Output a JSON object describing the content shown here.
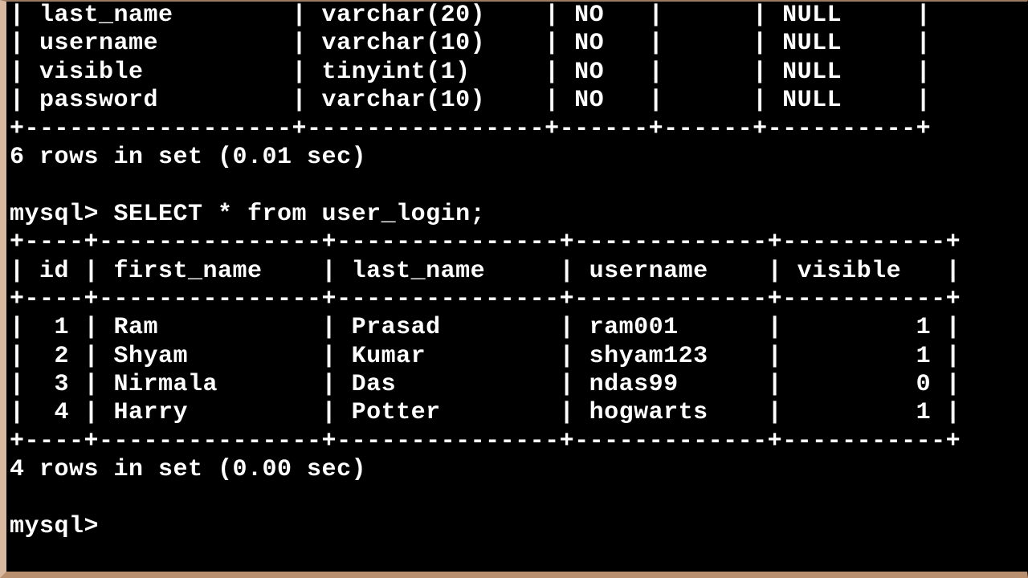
{
  "describe_table": {
    "rows": [
      {
        "field": "last_name",
        "type": "varchar(20)",
        "null": "NO",
        "key": "",
        "default": "NULL"
      },
      {
        "field": "username",
        "type": "varchar(10)",
        "null": "NO",
        "key": "",
        "default": "NULL"
      },
      {
        "field": "visible",
        "type": "tinyint(1)",
        "null": "NO",
        "key": "",
        "default": "NULL"
      },
      {
        "field": "password",
        "type": "varchar(10)",
        "null": "NO",
        "key": "",
        "default": "NULL"
      }
    ],
    "footer": "6 rows in set (0.01 sec)"
  },
  "query": {
    "prompt": "mysql>",
    "sql": "SELECT * from user_login;"
  },
  "result_table": {
    "headers": [
      "id",
      "first_name",
      "last_name",
      "username",
      "visible"
    ],
    "rows": [
      {
        "id": "1",
        "first_name": "Ram",
        "last_name": "Prasad",
        "username": "ram001",
        "visible": "1"
      },
      {
        "id": "2",
        "first_name": "Shyam",
        "last_name": "Kumar",
        "username": "shyam123",
        "visible": "1"
      },
      {
        "id": "3",
        "first_name": "Nirmala",
        "last_name": "Das",
        "username": "ndas99",
        "visible": "0"
      },
      {
        "id": "4",
        "first_name": "Harry",
        "last_name": "Potter",
        "username": "hogwarts",
        "visible": "1"
      }
    ],
    "footer": "4 rows in set (0.00 sec)"
  },
  "prompt_final": "mysql>",
  "layout": {
    "col_field": 18,
    "col_type": 16,
    "col_null": 6,
    "col_key": 6,
    "col_def": 10,
    "c_id": 4,
    "c_fn": 15,
    "c_ln": 15,
    "c_un": 13,
    "c_vis": 11,
    "dash": "-",
    "plus": "+",
    "pipe": "|"
  }
}
